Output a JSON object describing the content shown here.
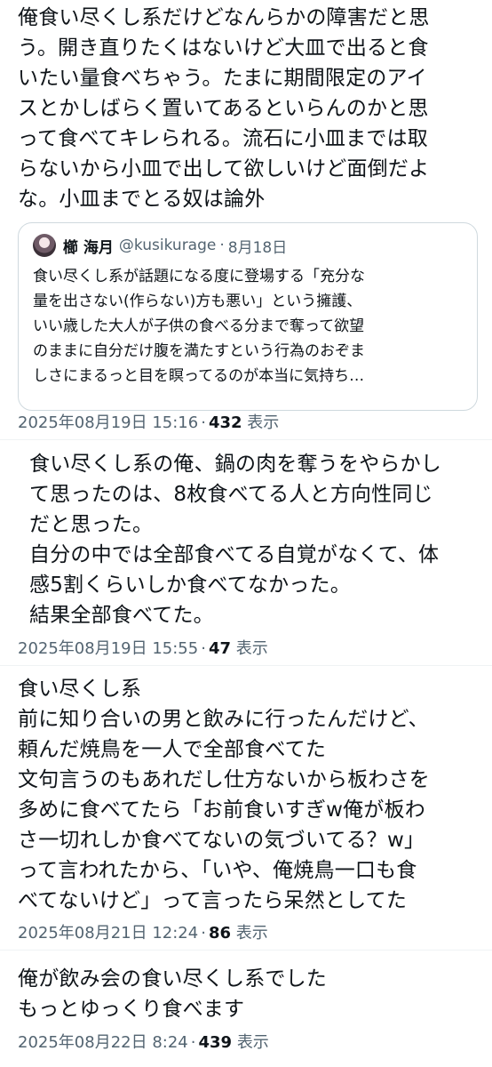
{
  "replies": [
    {
      "text": "俺食い尽くし系だけどなんらかの障害だと思\nう。開き直りたくはないけど大皿で出ると食\nいたい量食べちゃう。たまに期間限定のアイ\nスとかしばらく置いてあるといらんのかと思\nって食べてキレられる。流石に小皿までは取\nらないから小皿で出して欲しいけど面倒だよ\nな。小皿までとる奴は論外",
      "quote": {
        "name": "櫛 海月",
        "handle": "@kusikurage",
        "dot": "·",
        "date": "8月18日",
        "text": "食い尽くし系が話題になる度に登場する「充分な\n量を出さない(作らない)方も悪い」という擁護、\nいい歳した大人が子供の食べる分まで奪って欲望\nのままに自分だけ腹を満たすという行為のおぞま\nしさにまるっと目を瞑ってるのが本当に気持ち…"
      },
      "timestamp": "2025年08月19日 15:16",
      "sep": "·",
      "views_count": "432",
      "views_label": "表示"
    },
    {
      "text": "食い尽くし系の俺、鍋の肉を奪うをやらかし\nて思ったのは、8枚食べてる人と方向性同じ\nだと思った。\n自分の中では全部食べてる自覚がなくて、体\n感5割くらいしか食べてなかった。\n結果全部食べてた。",
      "timestamp": "2025年08月19日 15:55",
      "sep": "·",
      "views_count": "47",
      "views_label": "表示"
    },
    {
      "text": "食い尽くし系\n前に知り合いの男と飲みに行ったんだけど、\n頼んだ焼鳥を一人で全部食べてた\n文句言うのもあれだし仕方ないから板わさを\n多めに食べてたら「お前食いすぎw俺が板わ\nさ一切れしか食べてないの気づいてる？w」\nって言われたから、「いや、俺焼鳥一口も食\nべてないけど」って言ったら呆然としてた",
      "timestamp": "2025年08月21日 12:24",
      "sep": "·",
      "views_count": "86",
      "views_label": "表示"
    },
    {
      "text": "俺が飲み会の食い尽くし系でした\nもっとゆっくり食べます",
      "timestamp": "2025年08月22日 8:24",
      "sep": "·",
      "views_count": "439",
      "views_label": "表示"
    }
  ]
}
